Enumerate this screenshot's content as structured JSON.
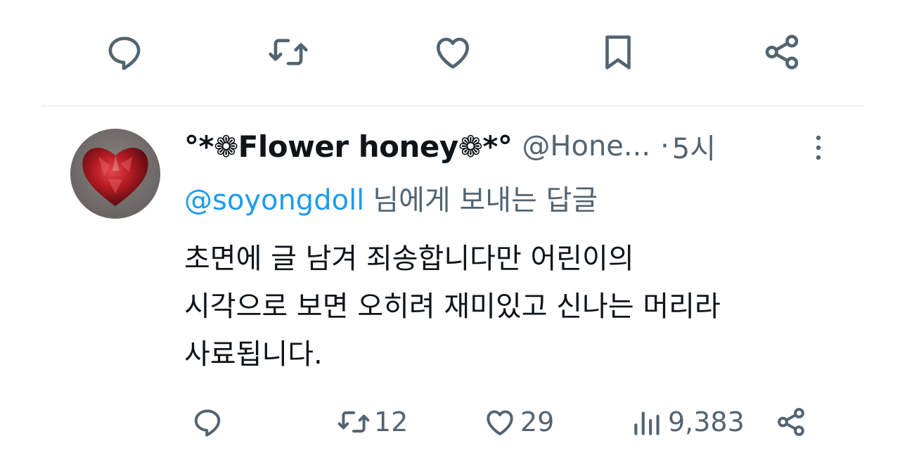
{
  "top_actions": [
    {
      "icon": "reply-icon"
    },
    {
      "icon": "retweet-icon"
    },
    {
      "icon": "heart-icon"
    },
    {
      "icon": "bookmark-icon"
    },
    {
      "icon": "share-icon"
    }
  ],
  "reply": {
    "display_name": "°*❁Flower honey❁*°",
    "handle": "@Hone...",
    "separator": "·",
    "time": "5시",
    "reply_to_mention": "@soyongdoll",
    "reply_to_suffix": "님에게 보내는 답글",
    "text_lines": [
      "초면에 글 남겨 죄송합니다만 어린이의",
      "시각으로 보면 오히려 재미있고 신나는 머리라",
      "사료됩니다."
    ],
    "actions": {
      "retweets": "12",
      "likes": "29",
      "views": "9,383"
    }
  },
  "colors": {
    "accent": "#1d9bf0",
    "icon_gray": "#536471",
    "text": "#0f1419"
  }
}
